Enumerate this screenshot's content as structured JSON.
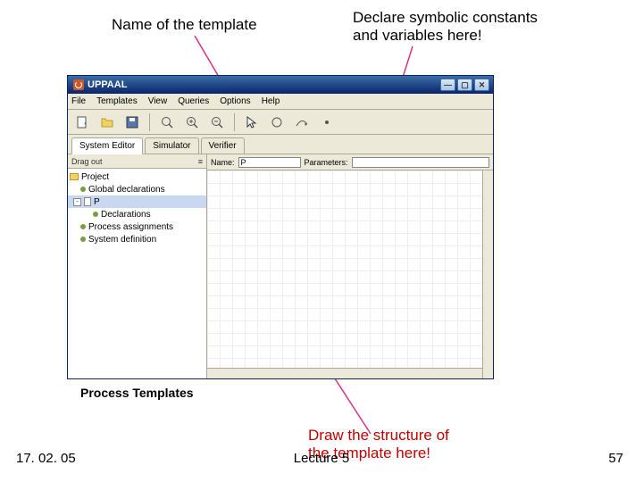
{
  "annotations": {
    "top_left": "Name of the template",
    "top_right": "Declare symbolic constants\nand variables here!",
    "bottom_red": "Draw the structure of\nthe template here!"
  },
  "caption": "Process Templates",
  "footer": {
    "date": "17. 02. 05",
    "lecture": "Lecture 5",
    "page": "57"
  },
  "window": {
    "title": "UPPAAL",
    "menu": [
      "File",
      "Templates",
      "View",
      "Queries",
      "Options",
      "Help"
    ],
    "tabs": [
      "System Editor",
      "Simulator",
      "Verifier"
    ],
    "dragout": "Drag out",
    "name_label": "Name:",
    "name_value": "P",
    "params_label": "Parameters:",
    "params_value": "",
    "tree": {
      "project": "Project",
      "global_decl": "Global declarations",
      "p": "P",
      "declarations": "Declarations",
      "process_asg": "Process assignments",
      "system_def": "System definition"
    }
  }
}
